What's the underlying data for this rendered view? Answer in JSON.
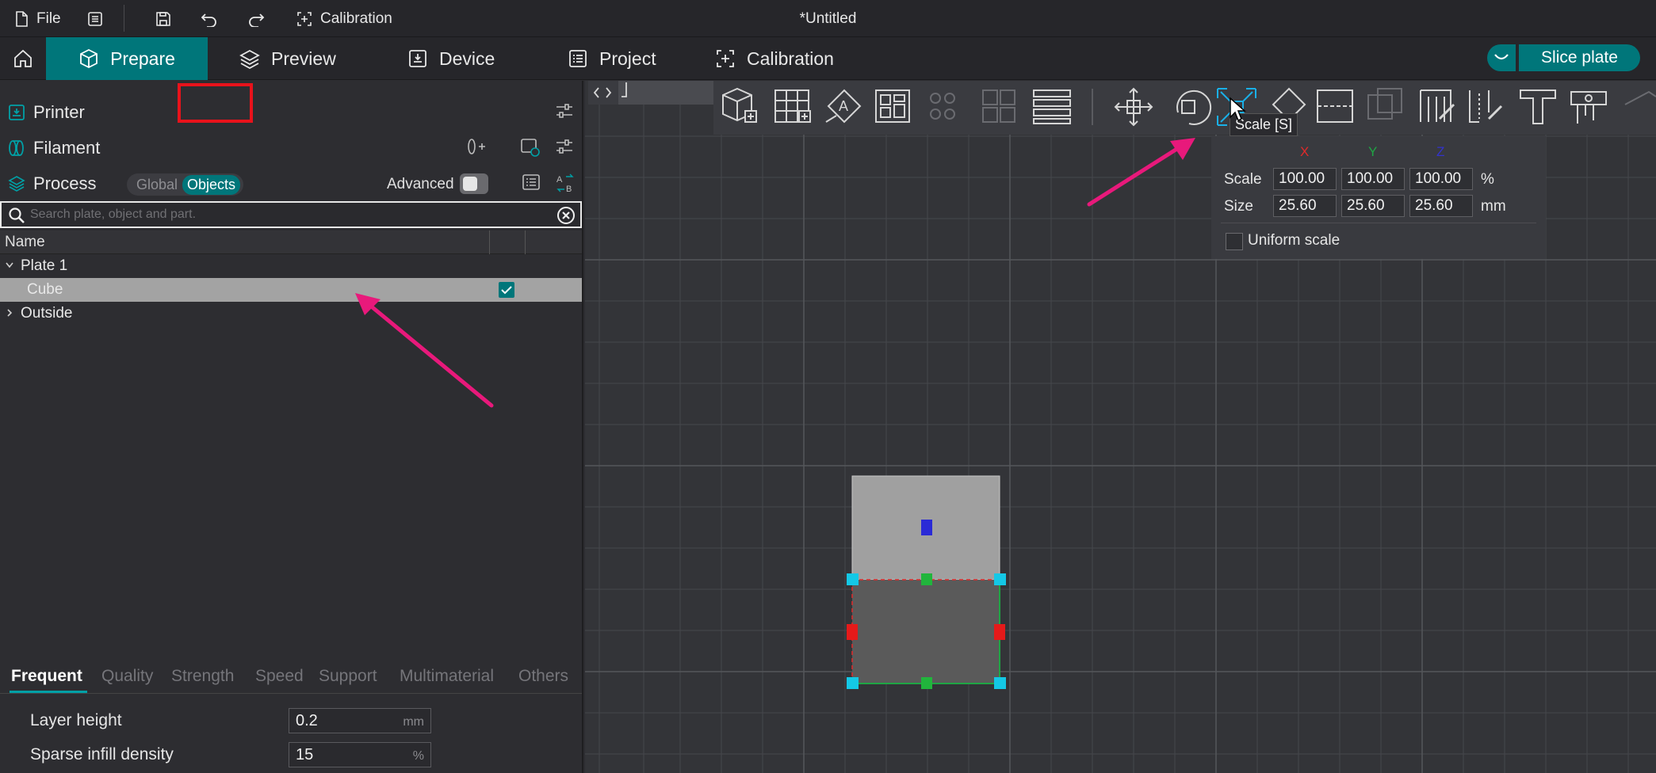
{
  "titlebar": {
    "file_label": "File",
    "calibration_label": "Calibration",
    "window_title": "*Untitled"
  },
  "tabs": [
    {
      "label": "Prepare",
      "active": true
    },
    {
      "label": "Preview",
      "active": false
    },
    {
      "label": "Device",
      "active": false
    },
    {
      "label": "Project",
      "active": false
    },
    {
      "label": "Calibration",
      "active": false
    }
  ],
  "slice_button": "Slice plate",
  "left_panel": {
    "printer_label": "Printer",
    "filament_label": "Filament",
    "process_label": "Process",
    "global_label": "Global",
    "objects_label": "Objects",
    "advanced_label": "Advanced",
    "search_placeholder": "Search plate, object and part.",
    "name_column": "Name",
    "tree": {
      "plate": "Plate 1",
      "cube": "Cube",
      "outside": "Outside"
    }
  },
  "param_tabs": [
    "Frequent",
    "Quality",
    "Strength",
    "Speed",
    "Support",
    "Multimaterial",
    "Others"
  ],
  "params": [
    {
      "label": "Layer height",
      "value": "0.2",
      "unit": "mm"
    },
    {
      "label": "Sparse infill density",
      "value": "15",
      "unit": "%"
    }
  ],
  "scale_tooltip": "Scale [S]",
  "scale_panel": {
    "axes": [
      "X",
      "Y",
      "Z"
    ],
    "scale_label": "Scale",
    "scale_values": [
      "100.00",
      "100.00",
      "100.00"
    ],
    "scale_unit": "%",
    "size_label": "Size",
    "size_values": [
      "25.60",
      "25.60",
      "25.60"
    ],
    "size_unit": "mm",
    "uniform_label": "Uniform scale"
  },
  "colors": {
    "accent": "#00767a",
    "highlight_red": "#e8121b",
    "arrow_pink": "#e8197b",
    "axis_x": "#e02a2a",
    "axis_y": "#1fa544",
    "axis_z": "#3333cc"
  }
}
